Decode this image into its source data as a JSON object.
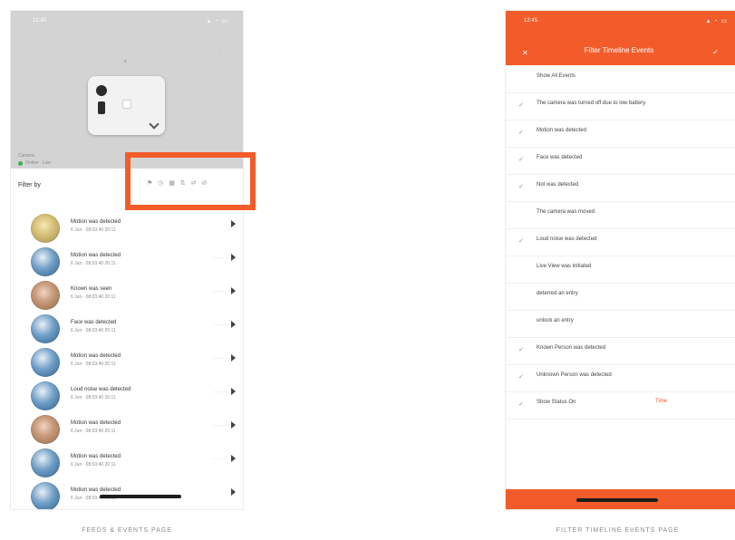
{
  "left_screen": {
    "status_bar": {
      "time": "12:45",
      "signal": "▴ ◔ ▭"
    },
    "camera": {
      "menu_icon": "more-vertical-icon",
      "caption": "Camera",
      "status": "Online · Live"
    },
    "filter": {
      "label": "Filter by",
      "icons": "⚑ ◷ ▦ ⇅ ⇄ ⊘"
    },
    "feed": [
      {
        "title": "Motion was detected",
        "subtitle": "6 Jun · 08:03:40 20:11",
        "more": "",
        "avatar": "yellowface"
      },
      {
        "title": "Motion was detected",
        "subtitle": "6 Jun · 08:03:40 20:11",
        "more": "······",
        "avatar": "sky"
      },
      {
        "title": "Known was seen",
        "subtitle": "6 Jun · 08:03:40 20:11",
        "more": "······",
        "avatar": "face"
      },
      {
        "title": "Face was detected",
        "subtitle": "6 Jun · 08:03:40 20:11",
        "more": "······",
        "avatar": "sky"
      },
      {
        "title": "Motion was detected",
        "subtitle": "6 Jun · 08:03:40 20:11",
        "more": "······",
        "avatar": "sky"
      },
      {
        "title": "Loud noise was detected",
        "subtitle": "6 Jun · 08:03:40 20:11",
        "more": "······",
        "avatar": "sky"
      },
      {
        "title": "Motion was detected",
        "subtitle": "6 Jun · 08:03:40 20:11",
        "more": "······",
        "avatar": "face"
      },
      {
        "title": "Motion was detected",
        "subtitle": "6 Jun · 08:03:40 20:11",
        "more": "······",
        "avatar": "sky"
      },
      {
        "title": "Motion was detected",
        "subtitle": "6 Jun · 08:03:40 20:11",
        "more": "",
        "avatar": "sky"
      }
    ]
  },
  "right_screen": {
    "status_bar": {
      "time": "12:45",
      "signal": "▴ ◔ ▭"
    },
    "nav": {
      "close": "✕",
      "title": "Filter Timeline Events",
      "confirm": "✓"
    },
    "options": [
      {
        "label": "Show All Events",
        "checked": false,
        "extra": ""
      },
      {
        "label": "The camera was turned off due to low battery",
        "checked": true,
        "extra": ""
      },
      {
        "label": "Motion was detected",
        "checked": true,
        "extra": ""
      },
      {
        "label": "Face was detected",
        "checked": true,
        "extra": ""
      },
      {
        "label": "Not was detected",
        "checked": true,
        "extra": ""
      },
      {
        "label": "The camera was moved",
        "checked": false,
        "extra": ""
      },
      {
        "label": "Loud noise was detected",
        "checked": true,
        "extra": ""
      },
      {
        "label": "Live View was initiated",
        "checked": false,
        "extra": ""
      },
      {
        "label": "deterred an entry",
        "checked": false,
        "extra": ""
      },
      {
        "label": "unlock an entry",
        "checked": false,
        "extra": ""
      },
      {
        "label": "Known Person was detected",
        "checked": true,
        "extra": ""
      },
      {
        "label": "Unknown Person was detected",
        "checked": true,
        "extra": ""
      },
      {
        "label": "Show Status On",
        "checked": true,
        "extra": "Time"
      }
    ]
  },
  "captions": {
    "left": "FEEDS & EVENTS PAGE",
    "right": "FILTER TIMELINE EVENTS PAGE"
  },
  "colors": {
    "accent": "#f25c2b",
    "camera_bg": "#d3d3d3",
    "online": "#37b24d"
  }
}
